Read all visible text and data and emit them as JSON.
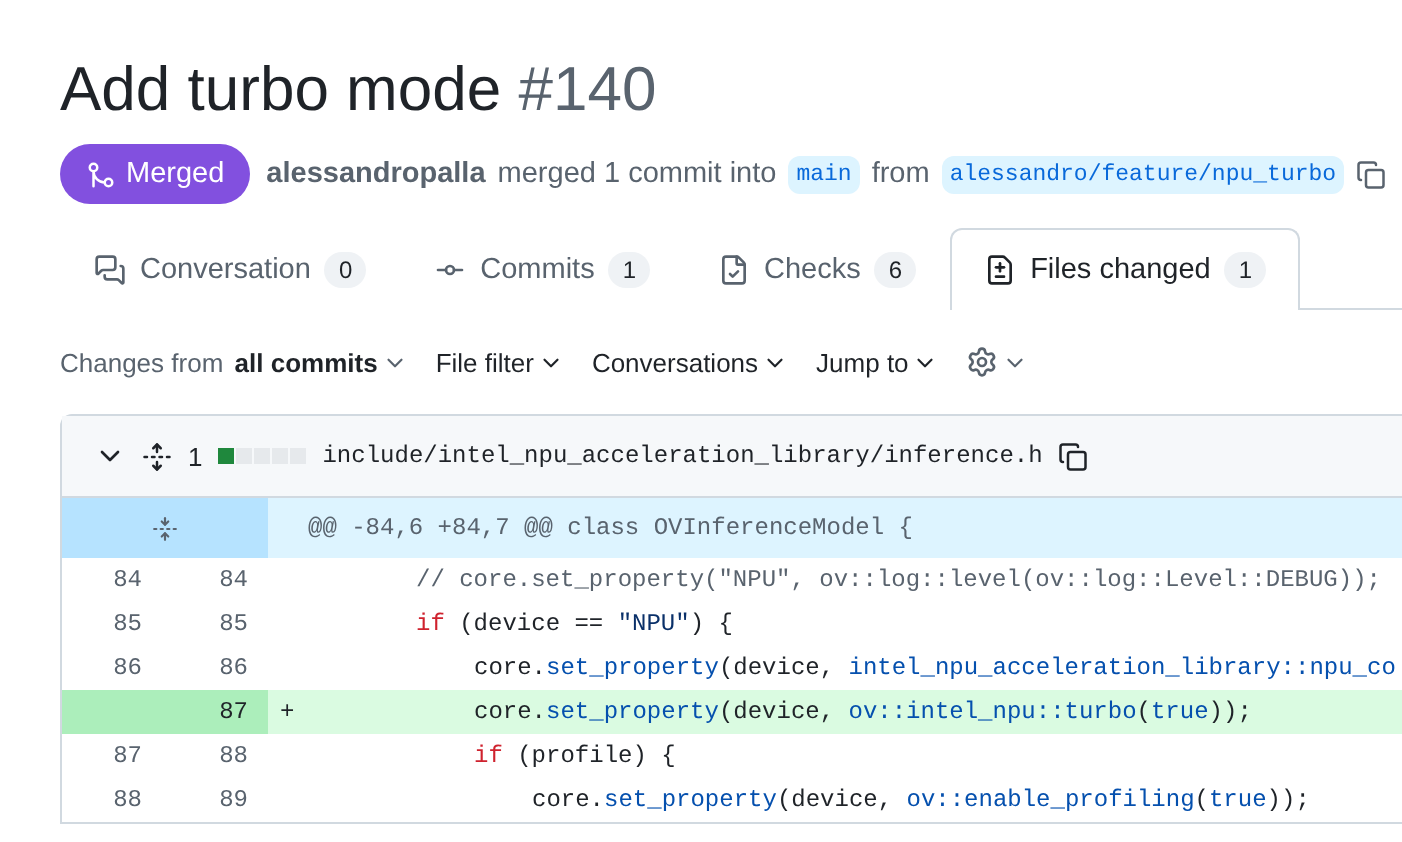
{
  "title": {
    "text": "Add turbo mode",
    "number": "#140"
  },
  "status": {
    "label": "Merged",
    "author": "alessandropalla",
    "summary": "merged 1 commit into",
    "base": "main",
    "from": "from",
    "head": "alessandro/feature/npu_turbo"
  },
  "tabs": [
    {
      "label": "Conversation",
      "count": "0",
      "kind": "conversation",
      "selected": false
    },
    {
      "label": "Commits",
      "count": "1",
      "kind": "commits",
      "selected": false
    },
    {
      "label": "Checks",
      "count": "6",
      "kind": "checks",
      "selected": false
    },
    {
      "label": "Files changed",
      "count": "1",
      "kind": "files",
      "selected": true
    }
  ],
  "toolbar": {
    "changes_prefix": "Changes from",
    "changes_value": "all commits",
    "filters": [
      "File filter",
      "Conversations",
      "Jump to"
    ]
  },
  "file": {
    "changes": "1",
    "stat_blocks": [
      {
        "kind": "added"
      },
      {
        "kind": "neutral"
      },
      {
        "kind": "neutral"
      },
      {
        "kind": "neutral"
      },
      {
        "kind": "neutral"
      }
    ],
    "path": "include/intel_npu_acceleration_library/inference.h",
    "hunk": "@@ -84,6 +84,7 @@ class OVInferenceModel {",
    "lines": [
      {
        "old": "84",
        "new": "84",
        "kind": "context",
        "tokens": [
          {
            "text": "// core.set_property(\"NPU\", ov::log::level(ov::log::Level::DEBUG));",
            "kind": "comment"
          }
        ]
      },
      {
        "old": "85",
        "new": "85",
        "kind": "context",
        "tokens": [
          {
            "text": "if",
            "kind": "keyword"
          },
          {
            "text": " (device == ",
            "kind": "plain"
          },
          {
            "text": "\"NPU\"",
            "kind": "string"
          },
          {
            "text": ") {",
            "kind": "plain"
          }
        ],
        "children": [
          {
            "old": "86",
            "new": "86",
            "kind": "context",
            "tokens": [
              {
                "text": "core.",
                "kind": "plain"
              },
              {
                "text": "set_property",
                "kind": "func"
              },
              {
                "text": "(device, ",
                "kind": "plain"
              },
              {
                "text": "intel_npu_acceleration_library::npu_co",
                "kind": "const"
              }
            ]
          },
          {
            "new": "87",
            "kind": "added",
            "sign": "+",
            "tokens": [
              {
                "text": "core.",
                "kind": "plain"
              },
              {
                "text": "set_property",
                "kind": "func"
              },
              {
                "text": "(device, ",
                "kind": "plain"
              },
              {
                "text": "ov::intel_npu::turbo",
                "kind": "const"
              },
              {
                "text": "(",
                "kind": "plain"
              },
              {
                "text": "true",
                "kind": "const"
              },
              {
                "text": "));",
                "kind": "plain"
              }
            ]
          },
          {
            "old": "87",
            "new": "88",
            "kind": "context",
            "tokens": [
              {
                "text": "if",
                "kind": "keyword"
              },
              {
                "text": " (profile) {",
                "kind": "plain"
              }
            ],
            "children": [
              {
                "old": "88",
                "new": "89",
                "kind": "context",
                "tokens": [
                  {
                    "text": "core.",
                    "kind": "plain"
                  },
                  {
                    "text": "set_property",
                    "kind": "func"
                  },
                  {
                    "text": "(device, ",
                    "kind": "plain"
                  },
                  {
                    "text": "ov::enable_profiling",
                    "kind": "const"
                  },
                  {
                    "text": "(",
                    "kind": "plain"
                  },
                  {
                    "text": "true",
                    "kind": "const"
                  },
                  {
                    "text": "));",
                    "kind": "plain"
                  }
                ]
              }
            ]
          }
        ]
      }
    ]
  }
}
